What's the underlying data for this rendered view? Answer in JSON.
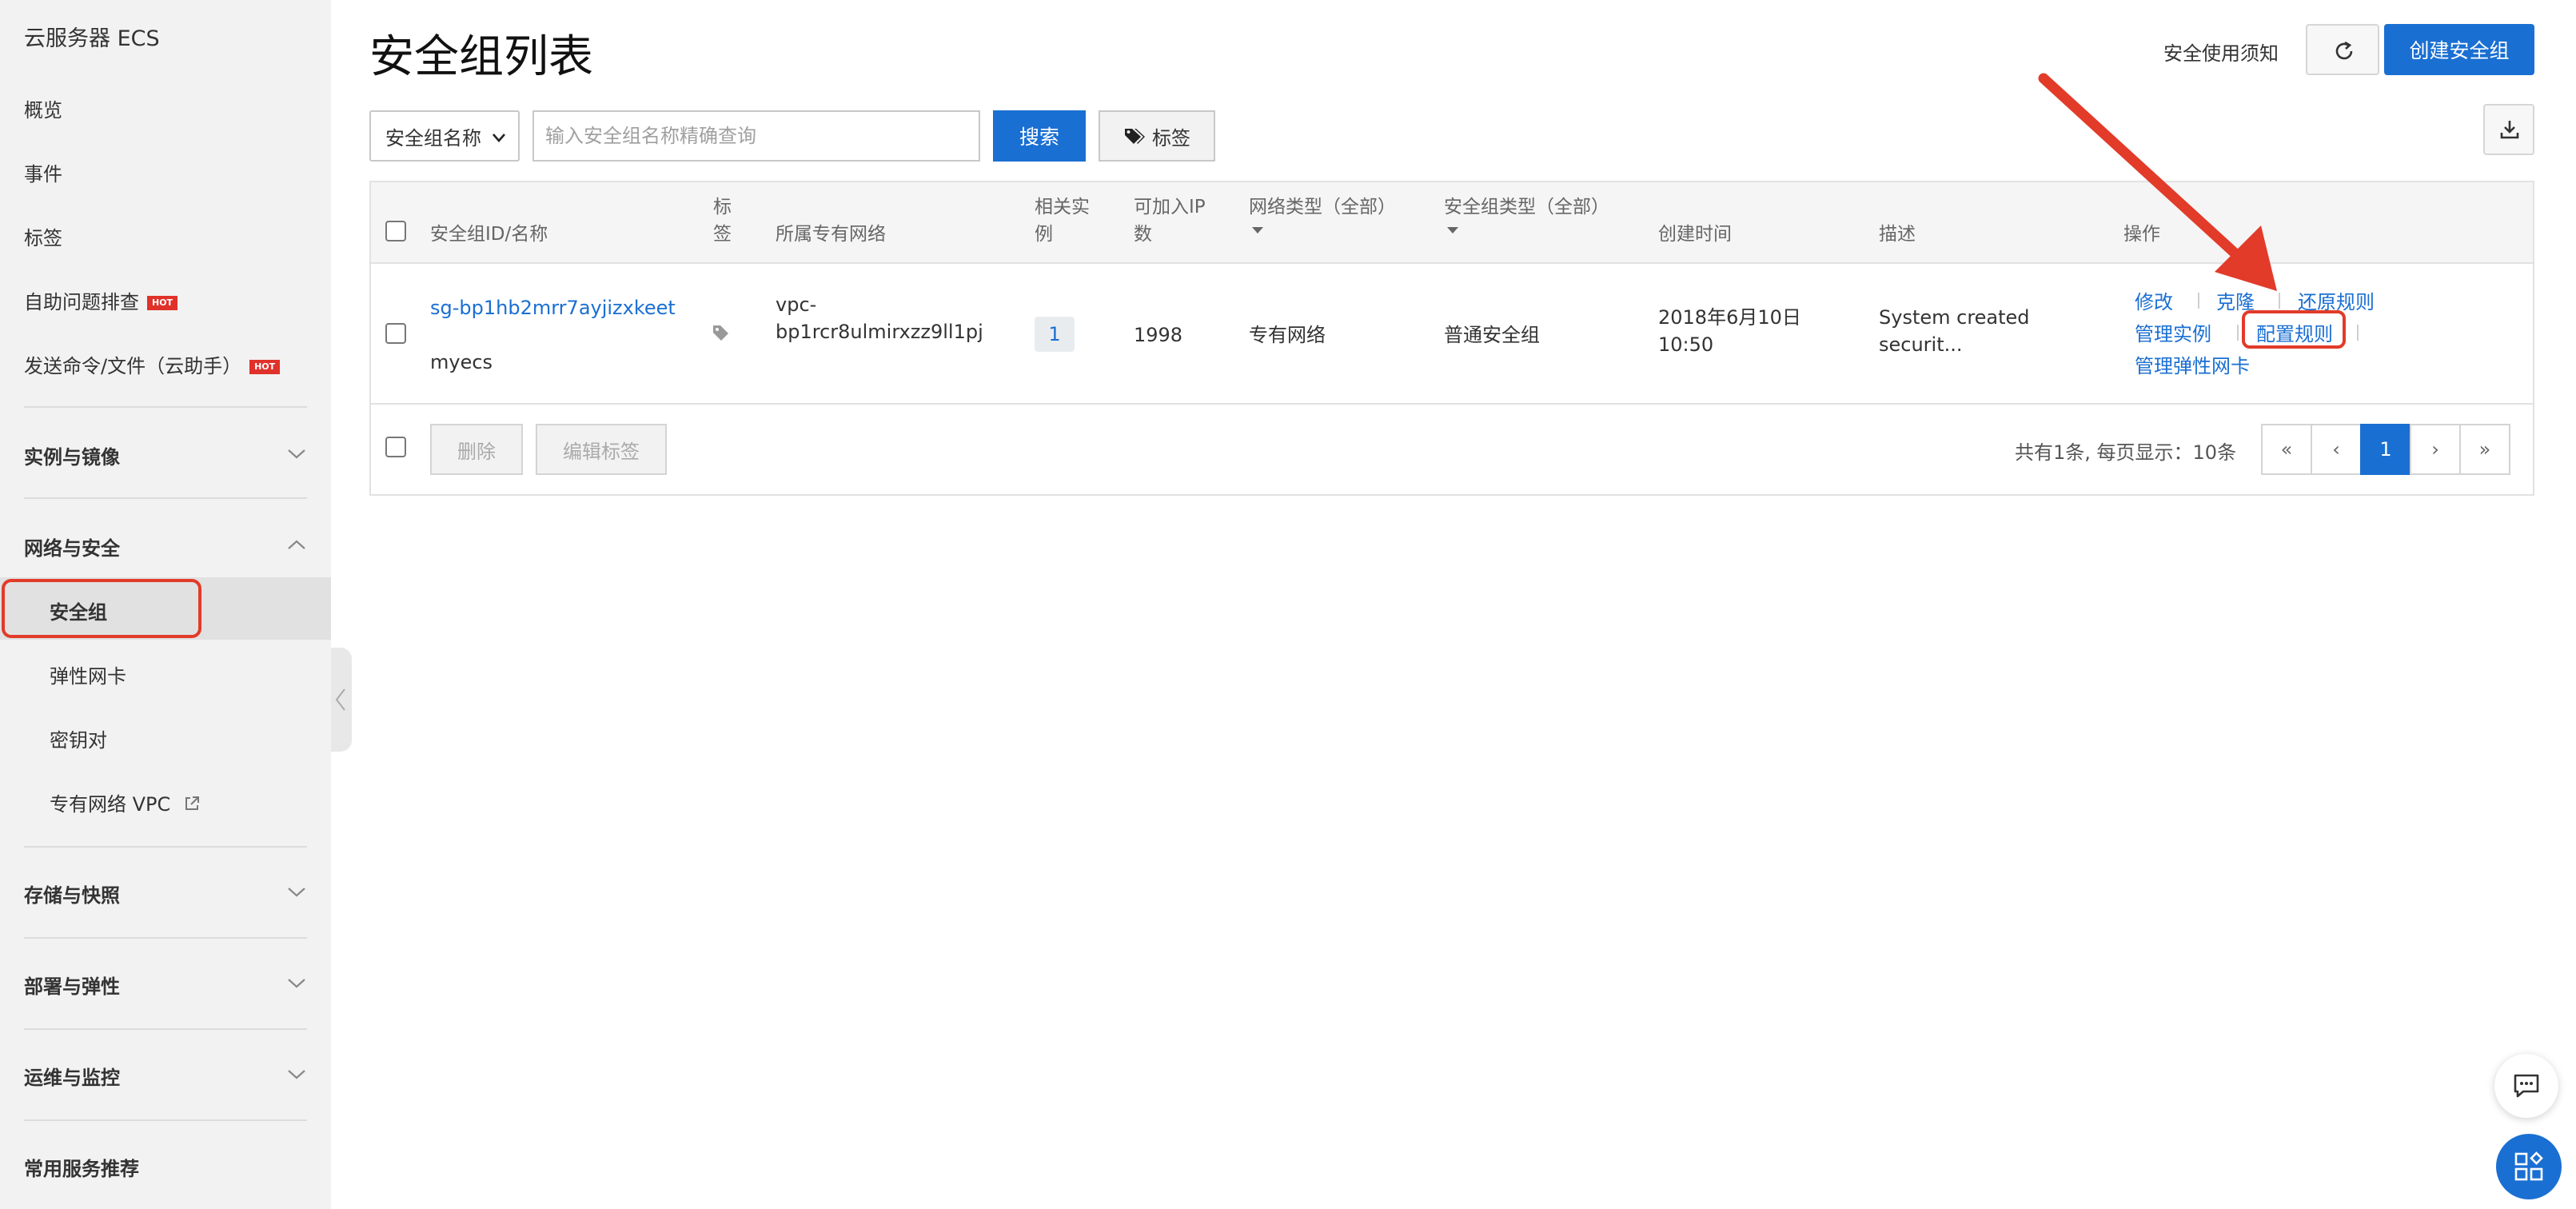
{
  "sidebar": {
    "title": "云服务器 ECS",
    "items": [
      {
        "label": "概览"
      },
      {
        "label": "事件"
      },
      {
        "label": "标签"
      },
      {
        "label": "自助问题排查",
        "badge": "HOT"
      },
      {
        "label": "发送命令/文件（云助手）",
        "badge": "HOT"
      }
    ],
    "groups": {
      "instances": "实例与镜像",
      "network": "网络与安全",
      "storage": "存储与快照",
      "deploy": "部署与弹性",
      "ops": "运维与监控",
      "common": "常用服务推荐"
    },
    "network_items": [
      {
        "label": "安全组"
      },
      {
        "label": "弹性网卡"
      },
      {
        "label": "密钥对"
      },
      {
        "label": "专有网络 VPC"
      }
    ]
  },
  "header": {
    "title": "安全组列表",
    "notice_link": "安全使用须知",
    "create_button": "创建安全组"
  },
  "filter": {
    "select_value": "安全组名称",
    "placeholder": "输入安全组名称精确查询",
    "search_button": "搜索",
    "tag_button": "标签"
  },
  "table": {
    "columns": {
      "id_name": "安全组ID/名称",
      "tag": "标\n签",
      "vpc": "所属专有网络",
      "instances": "相关实\n例",
      "available_ip": "可加入IP\n数",
      "network_type": "网络类型（全部）",
      "sg_type": "安全组类型（全部）",
      "created": "创建时间",
      "desc": "描述",
      "ops": "操作"
    },
    "rows": [
      {
        "id": "sg-bp1hb2mrr7ayjizxkeet",
        "name": "myecs",
        "vpc": "vpc-\nbp1rcr8ulmirxzz9ll1pj",
        "instances": "1",
        "available_ip": "1998",
        "network_type": "专有网络",
        "sg_type": "普通安全组",
        "created": "2018年6月10日\n10:50",
        "desc": "System created\nsecurit...",
        "ops": {
          "modify": "修改",
          "clone": "克隆",
          "restore": "还原规则",
          "manage_instances": "管理实例",
          "configure_rules": "配置规则",
          "manage_eni": "管理弹性网卡"
        }
      }
    ]
  },
  "footer": {
    "delete_button": "删除",
    "edit_tags_button": "编辑标签",
    "page_info": "共有1条, 每页显示：10条",
    "pager": [
      "«",
      "‹",
      "1",
      "›",
      "»"
    ],
    "current_page": "1"
  },
  "colors": {
    "accent": "#1a6fd2",
    "highlight": "#e23b2a",
    "hot_badge": "#e0312a"
  }
}
